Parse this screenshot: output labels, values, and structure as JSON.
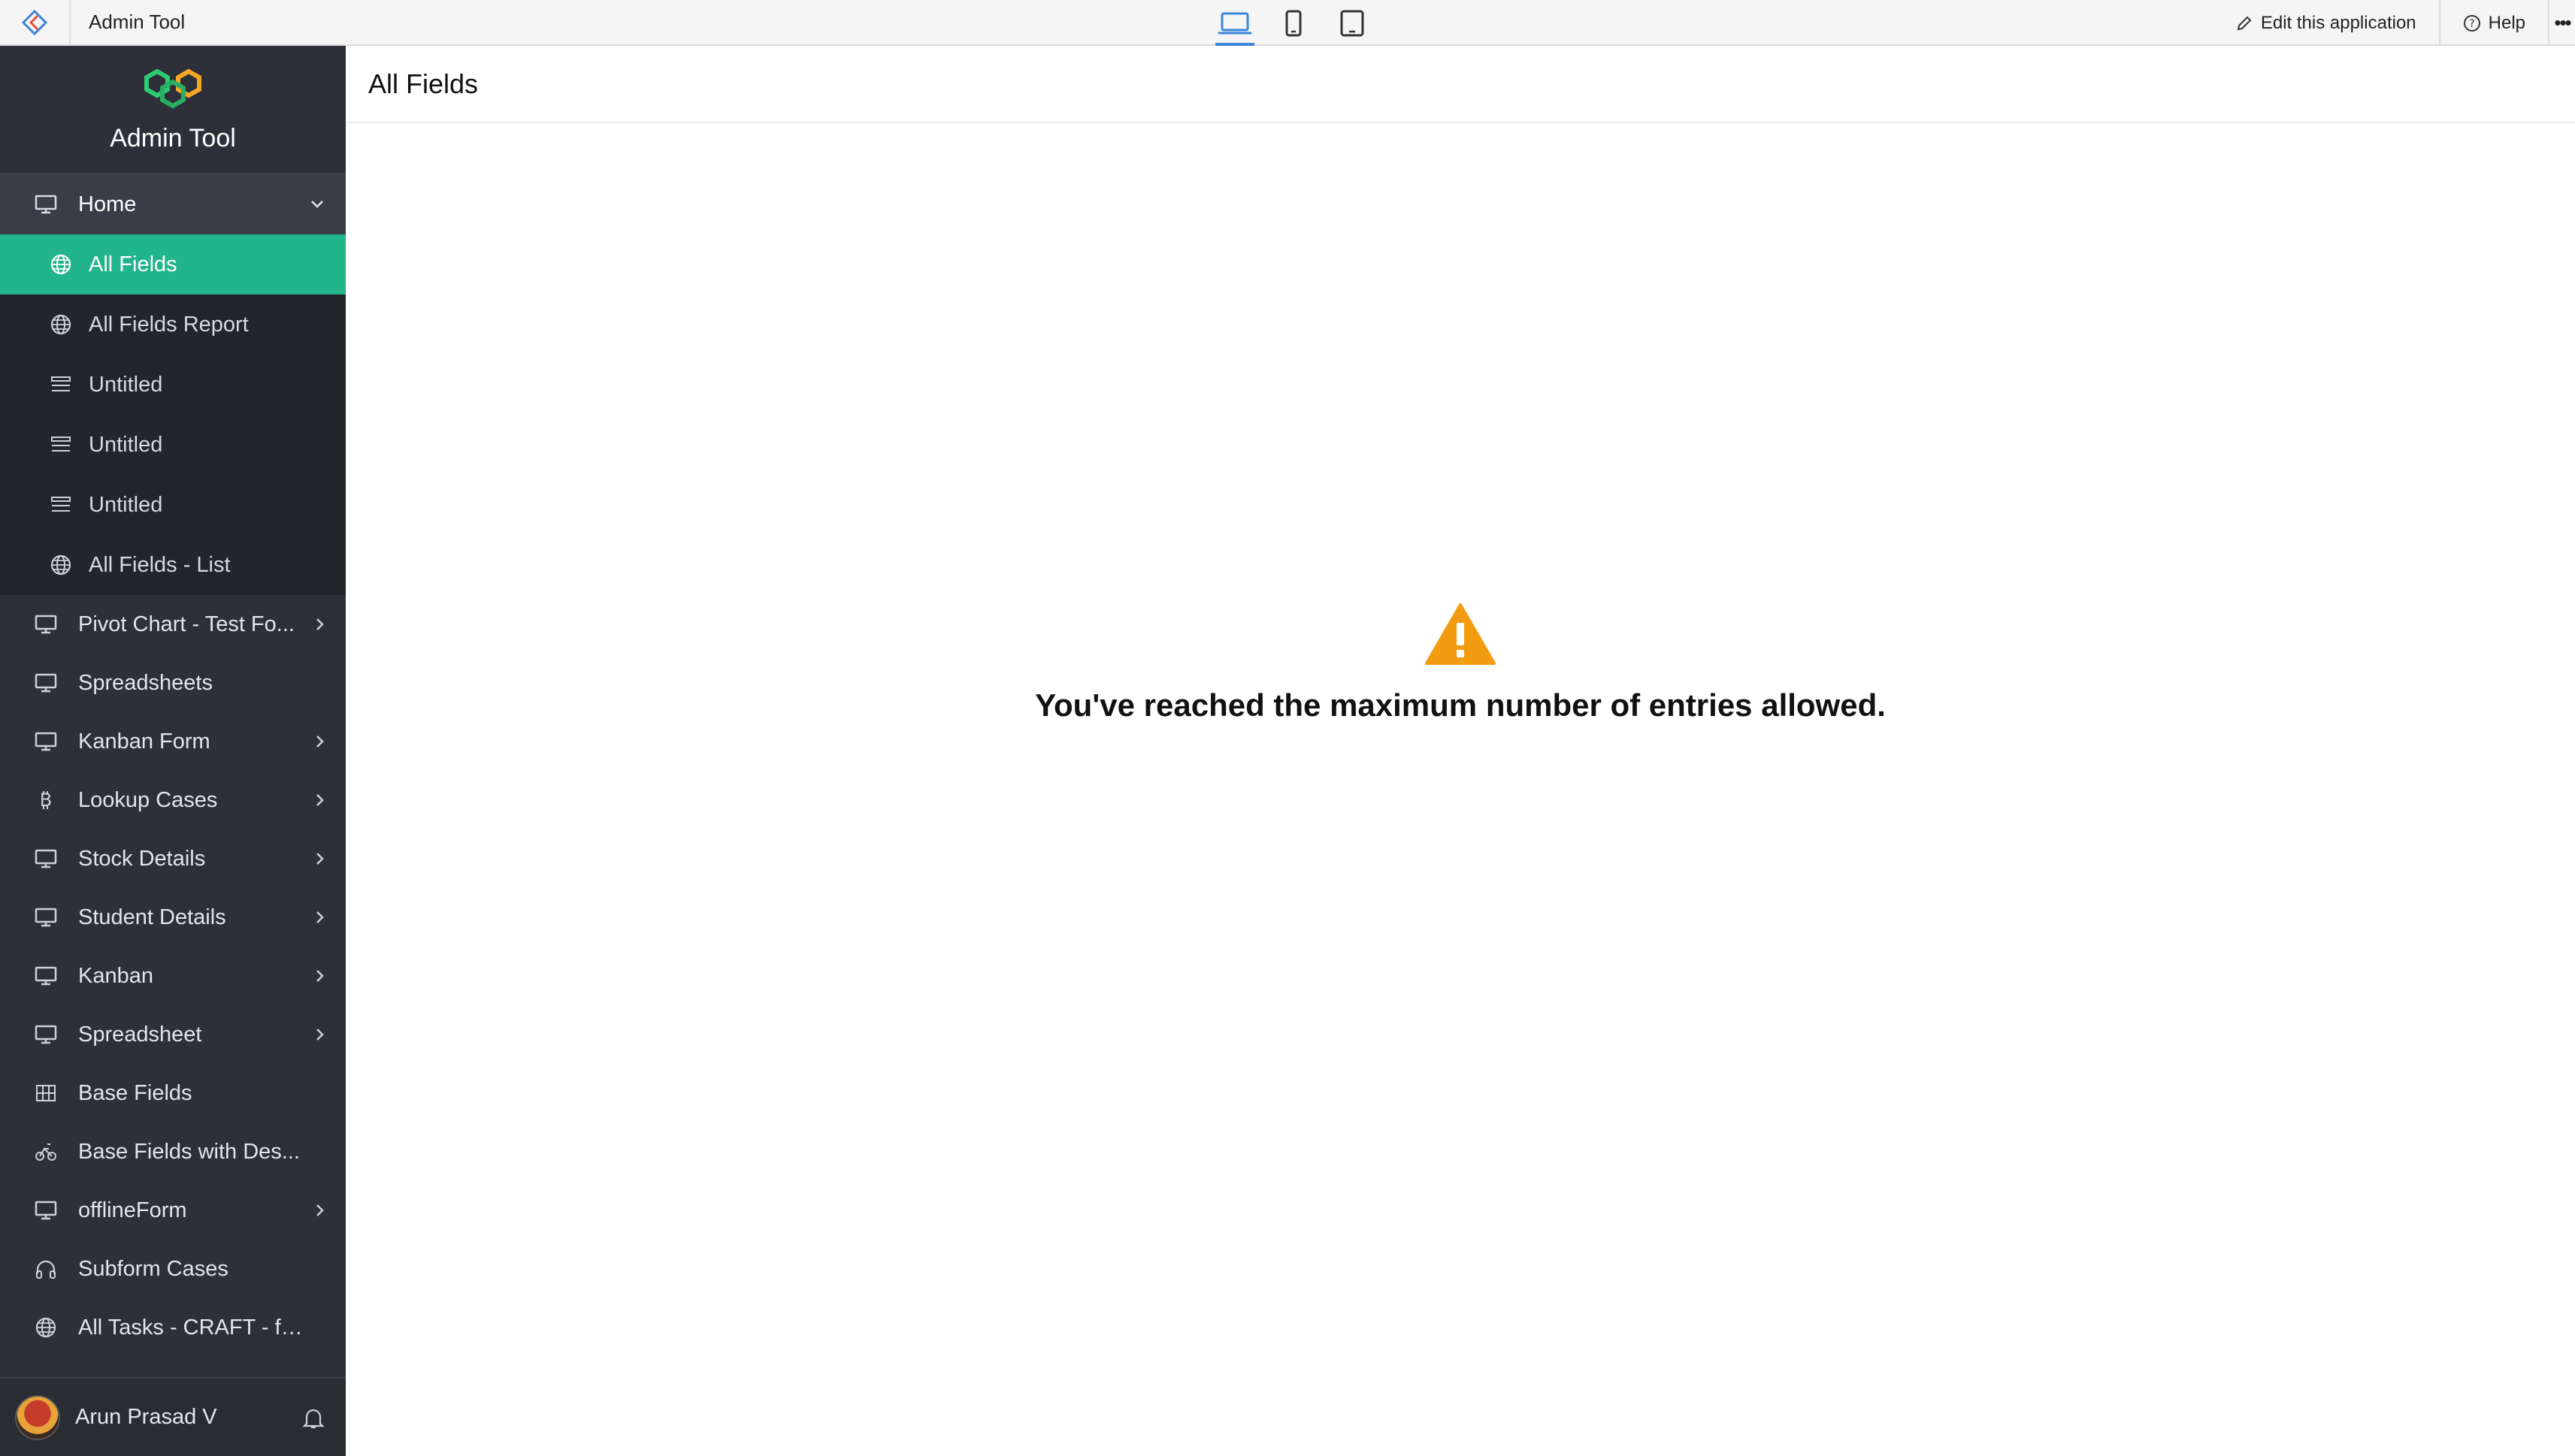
{
  "topbar": {
    "app_name": "Admin Tool",
    "devices": [
      {
        "name": "desktop-icon",
        "active": true
      },
      {
        "name": "mobile-icon",
        "active": false
      },
      {
        "name": "tablet-icon",
        "active": false
      }
    ],
    "edit_label": "Edit this application",
    "help_label": "Help",
    "more_label": "•••"
  },
  "sidebar": {
    "brand_name": "Admin Tool",
    "home_label": "Home",
    "sub_items": [
      {
        "label": "All Fields",
        "icon": "globe-icon",
        "active": true
      },
      {
        "label": "All Fields Report",
        "icon": "globe-icon",
        "active": false
      },
      {
        "label": "Untitled",
        "icon": "list-icon",
        "active": false
      },
      {
        "label": "Untitled",
        "icon": "list-icon",
        "active": false
      },
      {
        "label": "Untitled",
        "icon": "list-icon",
        "active": false
      },
      {
        "label": "All Fields - List",
        "icon": "globe-icon",
        "active": false
      }
    ],
    "items": [
      {
        "label": "Pivot Chart - Test Fo...",
        "icon": "monitor-icon",
        "chevron": true
      },
      {
        "label": "Spreadsheets",
        "icon": "monitor-icon",
        "chevron": false
      },
      {
        "label": "Kanban Form",
        "icon": "monitor-icon",
        "chevron": true
      },
      {
        "label": "Lookup Cases",
        "icon": "bitcoin-icon",
        "chevron": true
      },
      {
        "label": "Stock Details",
        "icon": "monitor-icon",
        "chevron": true
      },
      {
        "label": "Student Details",
        "icon": "monitor-icon",
        "chevron": true
      },
      {
        "label": "Kanban",
        "icon": "monitor-icon",
        "chevron": true
      },
      {
        "label": "Spreadsheet",
        "icon": "monitor-icon",
        "chevron": true
      },
      {
        "label": "Base Fields",
        "icon": "grid-icon",
        "chevron": false
      },
      {
        "label": "Base Fields with Des...",
        "icon": "bike-icon",
        "chevron": false
      },
      {
        "label": "offlineForm",
        "icon": "monitor-icon",
        "chevron": true
      },
      {
        "label": "Subform Cases",
        "icon": "headphones-icon",
        "chevron": false
      },
      {
        "label": "All Tasks - CRAFT - fo...",
        "icon": "globe-icon",
        "chevron": false
      }
    ],
    "user_name": "Arun Prasad V"
  },
  "main": {
    "page_title": "All Fields",
    "alert_message": "You've reached the maximum number of entries allowed."
  },
  "colors": {
    "sidebar_bg": "#2e3039",
    "active_item": "#22b48a",
    "warning": "#f39c12",
    "device_active": "#3a86d9"
  }
}
